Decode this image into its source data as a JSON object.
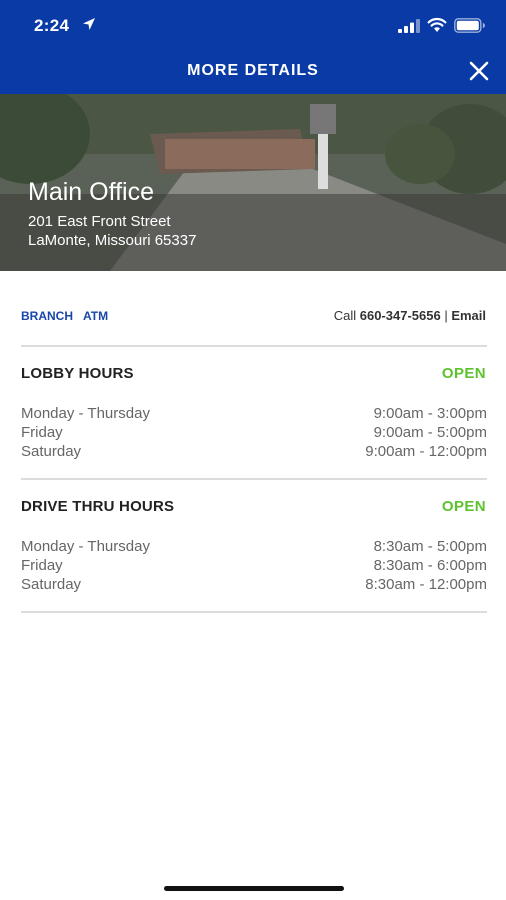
{
  "status_bar": {
    "time": "2:24"
  },
  "header": {
    "title": "MORE DETAILS"
  },
  "location": {
    "name": "Main Office",
    "address_line1": "201 East Front Street",
    "address_line2": "LaMonte, Missouri 65337"
  },
  "tabs": [
    {
      "label": "BRANCH"
    },
    {
      "label": "ATM"
    }
  ],
  "contact": {
    "call_label": "Call ",
    "phone": "660-347-5656",
    "separator": " | ",
    "email_label": "Email"
  },
  "lobby": {
    "title": "LOBBY HOURS",
    "status": "OPEN",
    "rows": [
      {
        "day": "Monday - Thursday",
        "hours": "9:00am - 3:00pm"
      },
      {
        "day": "Friday",
        "hours": "9:00am - 5:00pm"
      },
      {
        "day": "Saturday",
        "hours": "9:00am - 12:00pm"
      }
    ]
  },
  "drive_thru": {
    "title": "DRIVE THRU HOURS",
    "status": "OPEN",
    "rows": [
      {
        "day": "Monday - Thursday",
        "hours": "8:30am - 5:00pm"
      },
      {
        "day": "Friday",
        "hours": "8:30am - 6:00pm"
      },
      {
        "day": "Saturday",
        "hours": "8:30am - 12:00pm"
      }
    ]
  },
  "colors": {
    "header_bg": "#0a3aa6",
    "link": "#1946a8",
    "open": "#5ec22f"
  },
  "icons": [
    "location-arrow-icon",
    "cellular-signal-icon",
    "wifi-icon",
    "battery-icon",
    "close-icon"
  ]
}
